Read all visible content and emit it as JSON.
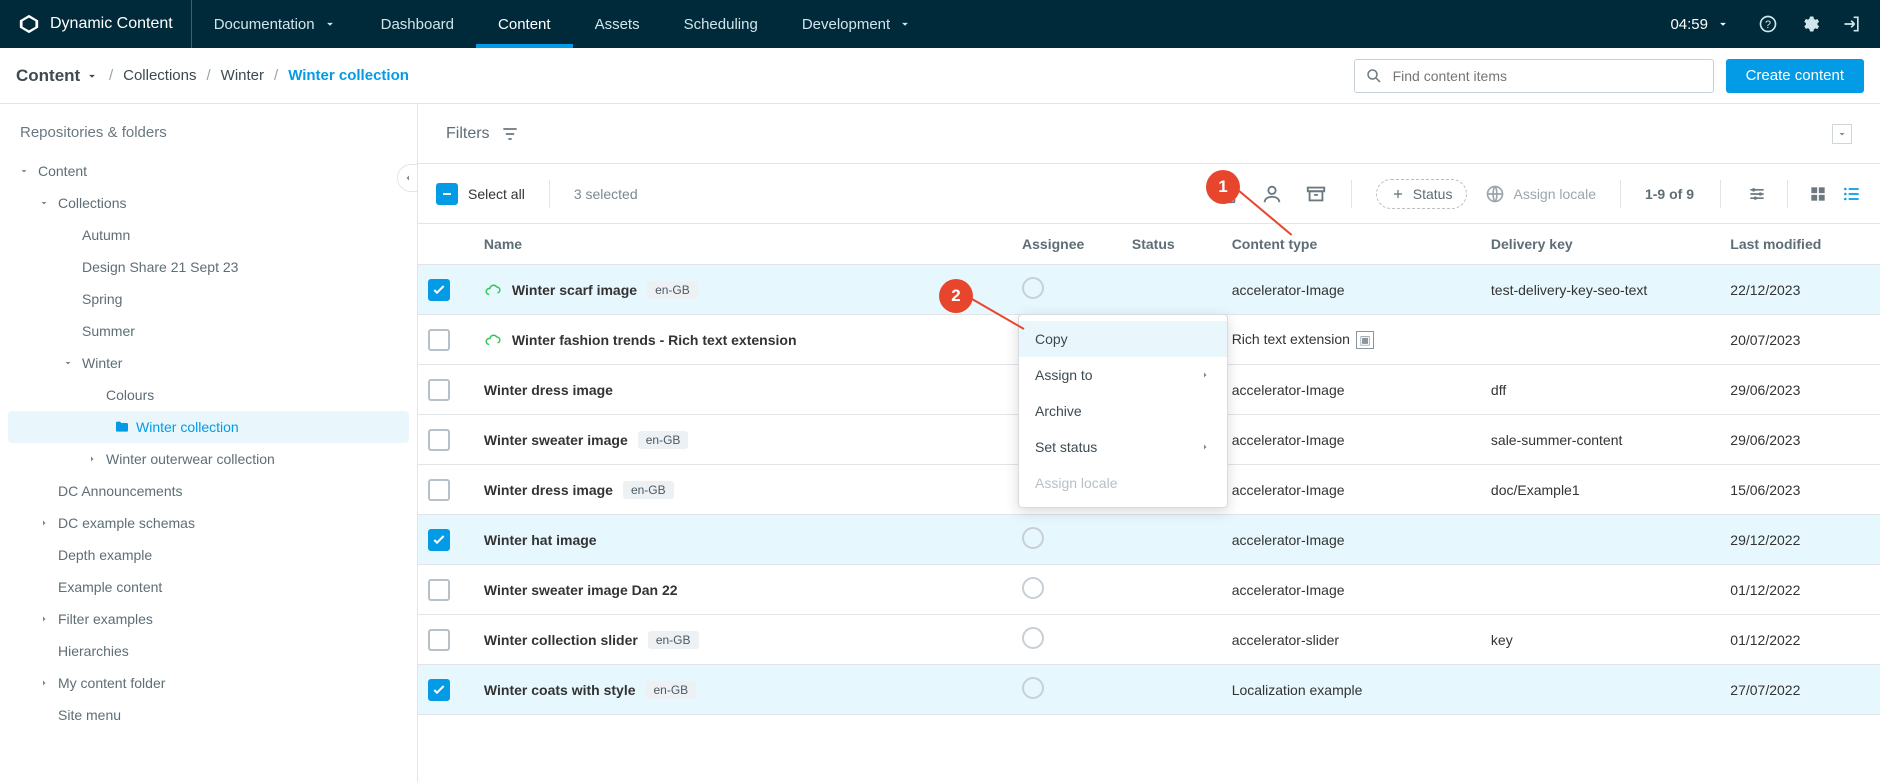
{
  "brand": "Dynamic Content",
  "topnav": [
    {
      "label": "Documentation",
      "has_caret": true,
      "active": false
    },
    {
      "label": "Dashboard",
      "has_caret": false,
      "active": false
    },
    {
      "label": "Content",
      "has_caret": false,
      "active": true
    },
    {
      "label": "Assets",
      "has_caret": false,
      "active": false
    },
    {
      "label": "Scheduling",
      "has_caret": false,
      "active": false
    },
    {
      "label": "Development",
      "has_caret": true,
      "active": false
    }
  ],
  "timer": "04:59",
  "breadcrumb": {
    "root": "Content",
    "items": [
      "Collections",
      "Winter"
    ],
    "current": "Winter collection"
  },
  "search_placeholder": "Find content items",
  "create_btn": "Create content",
  "sidepanel_title": "Repositories & folders",
  "tree": [
    {
      "label": "Content",
      "indent": 0,
      "twisty": "down",
      "selected": false
    },
    {
      "label": "Collections",
      "indent": 1,
      "twisty": "down",
      "selected": false
    },
    {
      "label": "Autumn",
      "indent": 2,
      "twisty": "",
      "selected": false
    },
    {
      "label": "Design Share 21 Sept 23",
      "indent": 2,
      "twisty": "",
      "selected": false
    },
    {
      "label": "Spring",
      "indent": 2,
      "twisty": "",
      "selected": false
    },
    {
      "label": "Summer",
      "indent": 2,
      "twisty": "",
      "selected": false
    },
    {
      "label": "Winter",
      "indent": 2,
      "twisty": "down",
      "selected": false
    },
    {
      "label": "Colours",
      "indent": 3,
      "twisty": "",
      "selected": false
    },
    {
      "label": "Winter collection",
      "indent": 3,
      "twisty": "",
      "selected": true,
      "folder": true
    },
    {
      "label": "Winter outerwear collection",
      "indent": 3,
      "twisty": "right",
      "selected": false
    },
    {
      "label": "DC Announcements",
      "indent": 1,
      "twisty": "",
      "selected": false
    },
    {
      "label": "DC example schemas",
      "indent": 1,
      "twisty": "right",
      "selected": false
    },
    {
      "label": "Depth example",
      "indent": 1,
      "twisty": "",
      "selected": false
    },
    {
      "label": "Example content",
      "indent": 1,
      "twisty": "",
      "selected": false
    },
    {
      "label": "Filter examples",
      "indent": 1,
      "twisty": "right",
      "selected": false
    },
    {
      "label": "Hierarchies",
      "indent": 1,
      "twisty": "",
      "selected": false
    },
    {
      "label": "My content folder",
      "indent": 1,
      "twisty": "right",
      "selected": false
    },
    {
      "label": "Site menu",
      "indent": 1,
      "twisty": "",
      "selected": false
    }
  ],
  "filters_label": "Filters",
  "select_all_label": "Select all",
  "selected_count": "3 selected",
  "status_chip": "Status",
  "assign_locale_label": "Assign locale",
  "pager": "1-9 of 9",
  "columns": {
    "name": "Name",
    "assignee": "Assignee",
    "status": "Status",
    "type": "Content type",
    "key": "Delivery key",
    "modified": "Last modified"
  },
  "rows": [
    {
      "checked": true,
      "cloud": true,
      "name": "Winter scarf image",
      "locale": "en-GB",
      "type": "accelerator-Image",
      "key": "test-delivery-key-seo-text",
      "modified": "22/12/2023"
    },
    {
      "checked": false,
      "cloud": true,
      "name": "Winter fashion trends - Rich text extension",
      "locale": "",
      "type": "Rich text extension",
      "key": "",
      "modified": "20/07/2023",
      "ext_icon": true
    },
    {
      "checked": false,
      "cloud": false,
      "name": "Winter dress image",
      "locale": "",
      "type": "accelerator-Image",
      "key": "dff",
      "modified": "29/06/2023"
    },
    {
      "checked": false,
      "cloud": false,
      "name": "Winter sweater image",
      "locale": "en-GB",
      "type": "accelerator-Image",
      "key": "sale-summer-content",
      "modified": "29/06/2023"
    },
    {
      "checked": false,
      "cloud": false,
      "name": "Winter dress image",
      "locale": "en-GB",
      "type": "accelerator-Image",
      "key": "doc/Example1",
      "modified": "15/06/2023"
    },
    {
      "checked": true,
      "cloud": false,
      "name": "Winter hat image",
      "locale": "",
      "type": "accelerator-Image",
      "key": "",
      "modified": "29/12/2022"
    },
    {
      "checked": false,
      "cloud": false,
      "name": "Winter sweater image Dan 22",
      "locale": "",
      "type": "accelerator-Image",
      "key": "",
      "modified": "01/12/2022"
    },
    {
      "checked": false,
      "cloud": false,
      "name": "Winter collection slider",
      "locale": "en-GB",
      "type": "accelerator-slider",
      "key": "key",
      "modified": "01/12/2022"
    },
    {
      "checked": true,
      "cloud": false,
      "name": "Winter coats with style",
      "locale": "en-GB",
      "type": "Localization example",
      "key": "",
      "modified": "27/07/2022"
    }
  ],
  "context_menu": {
    "items": [
      {
        "label": "Copy",
        "hover": true,
        "submenu": false,
        "disabled": false
      },
      {
        "label": "Assign to",
        "hover": false,
        "submenu": true,
        "disabled": false
      },
      {
        "label": "Archive",
        "hover": false,
        "submenu": false,
        "disabled": false
      },
      {
        "label": "Set status",
        "hover": false,
        "submenu": true,
        "disabled": false
      },
      {
        "label": "Assign locale",
        "hover": false,
        "submenu": false,
        "disabled": true
      }
    ]
  },
  "callouts": {
    "one": "1",
    "two": "2"
  }
}
